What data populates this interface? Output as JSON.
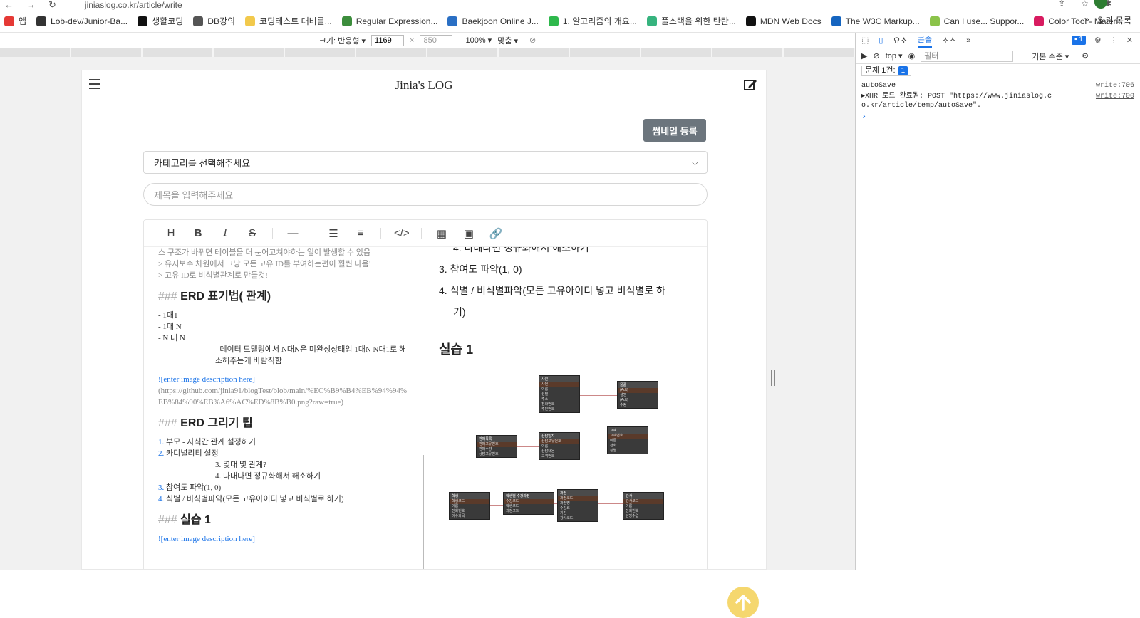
{
  "browser": {
    "url": "jiniaslog.co.kr/article/write",
    "bookmarks": [
      "앱",
      "Lob-dev/Junior-Ba...",
      "생활코딩",
      "DB강의",
      "코딩테스트 대비를...",
      "Regular Expression...",
      "Baekjoon Online J...",
      "1. 알고리즘의 개요...",
      "풀스택을 위한 탄탄...",
      "MDN Web Docs",
      "The W3C Markup...",
      "Can I use... Suppor...",
      "Color Tool - Materi..."
    ],
    "bookmark_colors": [
      "#e53935",
      "#333333",
      "#111111",
      "#555555",
      "#f2c94c",
      "#3c8d3c",
      "#2a6fc4",
      "#2eb84c",
      "#36b37e",
      "#111111",
      "#1565c0",
      "#8bc34a",
      "#d81b60"
    ],
    "reading_list": "읽기 목록",
    "more": "»"
  },
  "device_toolbar": {
    "size_label": "크기: 반응형 ▾",
    "width": "1169",
    "times": "×",
    "height": "850",
    "zoom": "100% ▾",
    "fit": "맞춤 ▾"
  },
  "blog": {
    "title": "Jinia's LOG",
    "thumbnail_button": "썸네일 등록",
    "category_placeholder": "카테고리를 선택해주세요",
    "title_placeholder": "제목을 입력해주세요"
  },
  "markdown": {
    "lines_top": [
      "스 구조가 바뀌면 테이블을 더 눈어고쳐야하는 일이 발생할 수 있음",
      "> 유지보수 차원에서 그냥 모든 고유 ID를 부여하는편이 훨씬 나음!",
      "> 고유 ID로 비식별관계로 만들것!"
    ],
    "h1_hash": "###",
    "h1_text": "ERD 표기법( 관계)",
    "list1": [
      "- 1대1",
      "- 1대 N",
      "- N 대 N"
    ],
    "note": "- 데이터 모델링에서 N대N은 미완성상태임 1대N N대1로 해소해주는게 바람직함",
    "img_link": "![enter image description here]",
    "img_url": "(https://github.com/jinia91/blogTest/blob/main/%EC%B9%B4%EB%94%94%EB%84%90%EB%A6%AC%ED%8B%B0.png?raw=true)",
    "h2_hash": "###",
    "h2_text": "ERD 그리기 팁",
    "tips": [
      {
        "num": "1.",
        "text": "부모 - 자식간 관계 설정하기"
      },
      {
        "num": "2.",
        "text": "카디널리티 설정"
      }
    ],
    "sub_tips": [
      "3. 몇대 몇 관계?",
      "4. 다대다면 정규화해서 해소하기"
    ],
    "tips2": [
      {
        "num": "3.",
        "text": "참여도 파악(1, 0)"
      },
      {
        "num": "4.",
        "text": "식별 / 비식별파악(모든 고유아이디 넣고 비식별로 하기)"
      }
    ],
    "h3_hash": "###",
    "h3_text": "실습 1",
    "img_link2": "![enter image description here]"
  },
  "preview": {
    "top_line": "4. 다대다면 정규화해서 해소하기",
    "item3": "3. 참여도 파악(1, 0)",
    "item4": "4. 식별 / 비식별파악(모든 고유아이디 넣고 비식별로 하",
    "item4b": "기)",
    "heading": "실습 1"
  },
  "erd_tables": [
    {
      "name": "사원",
      "rows": [
        "사번",
        "이름",
        "성별",
        "주소",
        "전화번호",
        "주민번호"
      ]
    },
    {
      "name": "물품",
      "rows": [
        "(Add)",
        "설명",
        "(Add)",
        "수량"
      ]
    },
    {
      "name": "판매목록",
      "rows": [
        "판매고유번호",
        "판매수량",
        "상담고유번호"
      ]
    },
    {
      "name": "상담일지",
      "rows": [
        "상담고유번호",
        "이름",
        "상담내용",
        "고객번호"
      ]
    },
    {
      "name": "고객",
      "rows": [
        "고객번호",
        "이름",
        "전화",
        "성별"
      ]
    },
    {
      "name": "학생",
      "rows": [
        "학생코드",
        "이름",
        "전화번호",
        "이수과목"
      ]
    },
    {
      "name": "학생별 수강과정",
      "rows": [
        "수강코드",
        "학생코드",
        "과정코드"
      ]
    },
    {
      "name": "과정",
      "rows": [
        "과정코드",
        "과정명",
        "수강료",
        "기간",
        "강사코드"
      ]
    },
    {
      "name": "강사",
      "rows": [
        "강사코드",
        "이름",
        "전화번호",
        "담당수업"
      ]
    }
  ],
  "devtools": {
    "tabs": [
      "요소",
      "콘솔",
      "소스"
    ],
    "active_tab": "콘솔",
    "more": "»",
    "badge": "1",
    "context": "top ▾",
    "filter_placeholder": "필터",
    "level": "기본 수준 ▾",
    "issues_label": "문제 1건:",
    "issues_count": "1",
    "logs": [
      {
        "text": "autoSave",
        "src": "write:706"
      },
      {
        "text": "▸XHR 로드 완료됨: POST \"https://www.jiniaslog.co.kr/article/temp/autoSave\".",
        "src": "write:700"
      }
    ],
    "prompt": "›"
  }
}
